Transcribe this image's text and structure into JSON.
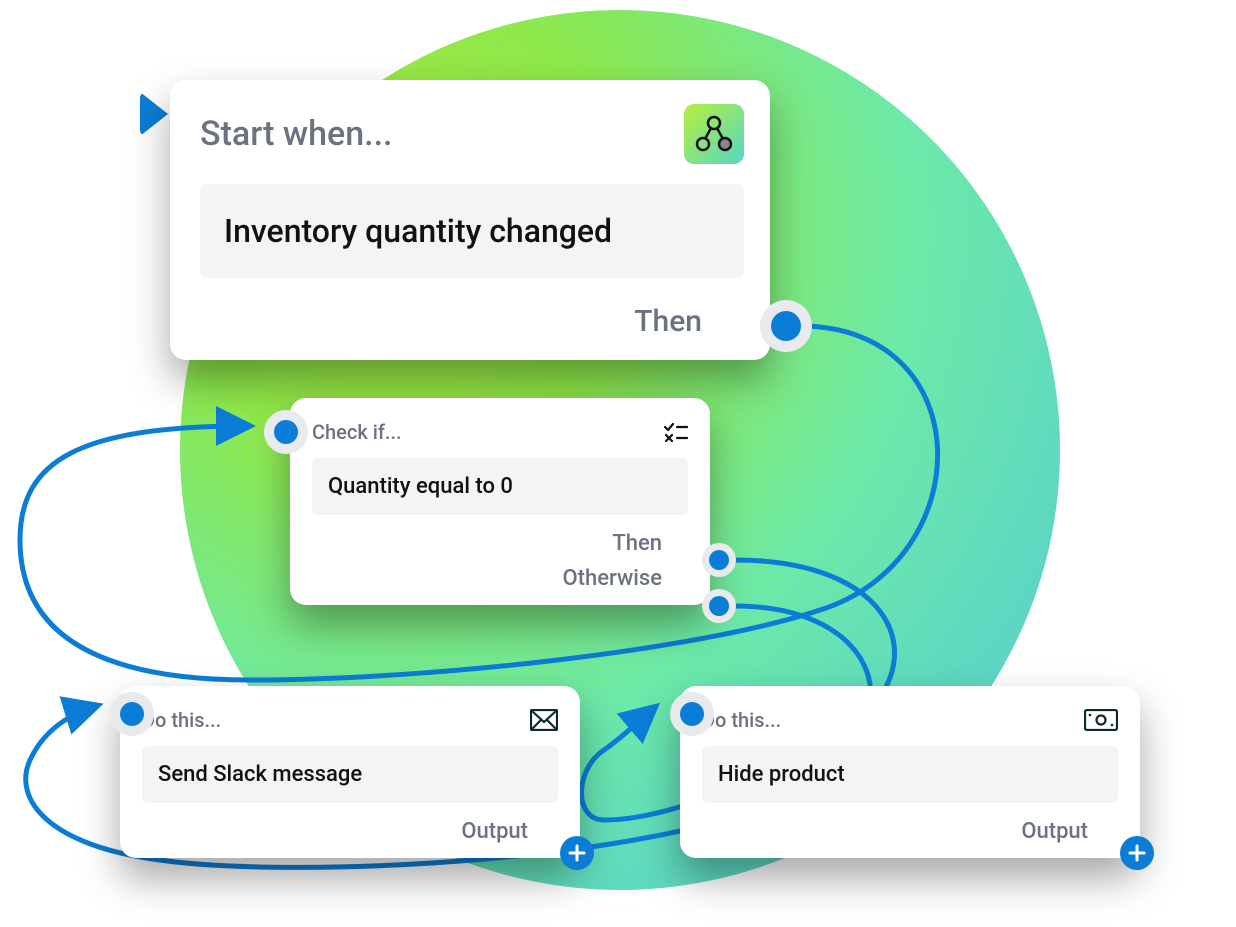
{
  "colors": {
    "accent": "#0b7dd6",
    "muted": "#6b7280",
    "card_bg": "#ffffff",
    "slot_bg": "#f3f4f6"
  },
  "icons": {
    "flow": "flow-icon",
    "checklist": "checklist-icon",
    "envelope": "envelope-icon",
    "money": "money-icon",
    "play": "play-icon",
    "plus": "plus-icon"
  },
  "start": {
    "title": "Start when...",
    "content": "Inventory quantity changed",
    "then_label": "Then"
  },
  "check": {
    "title": "Check if...",
    "content": "Quantity equal to 0",
    "then_label": "Then",
    "otherwise_label": "Otherwise"
  },
  "do1": {
    "title": "Do this...",
    "content": "Send Slack message",
    "output_label": "Output"
  },
  "do2": {
    "title": "Do this...",
    "content": "Hide product",
    "output_label": "Output"
  }
}
